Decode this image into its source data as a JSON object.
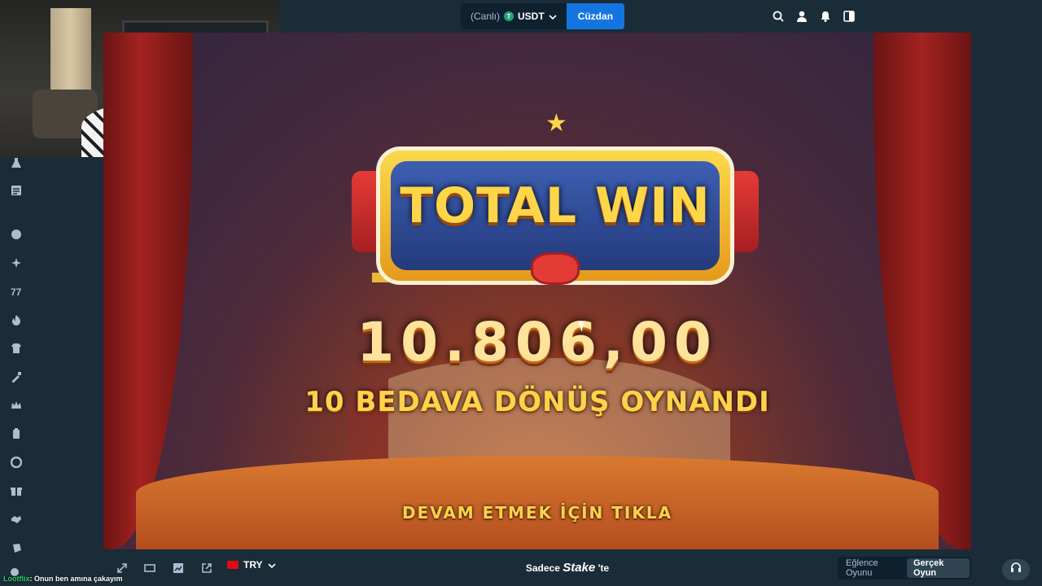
{
  "header": {
    "wallet_live": "(Canlı)",
    "wallet_currency": "USDT",
    "wallet_button": "Cüzdan"
  },
  "game": {
    "title": "TOTAL WIN",
    "win_amount": "10.806,00",
    "free_spins_text": "10 BEDAVA DÖNÜŞ OYNANDI",
    "continue_text": "DEVAM ETMEK İÇİN TIKLA"
  },
  "footer": {
    "currency": "TRY",
    "tagline_prefix": "Sadece",
    "tagline_brand": "Stake",
    "tagline_suffix": "'te",
    "mode_fun": "Eğlence Oyunu",
    "mode_real": "Gerçek Oyun"
  },
  "chat": {
    "user": "Lootflix",
    "message": ": Onun ben amına çakayım"
  },
  "colors": {
    "accent": "#1475e1",
    "background": "#1a2c38",
    "gold": "#ffd24a"
  }
}
